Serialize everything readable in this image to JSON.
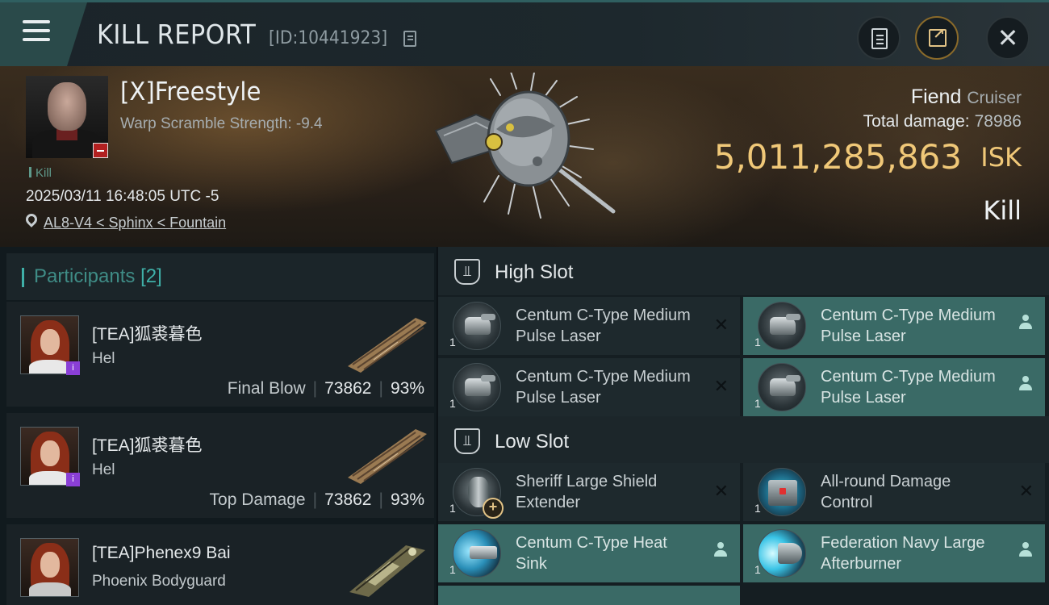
{
  "header": {
    "title": "KILL REPORT",
    "report_id": "[ID:10441923]",
    "icons": [
      "menu-icon",
      "copy-icon",
      "clipboard-icon",
      "share-icon",
      "close-icon"
    ],
    "close_glyph": "✕"
  },
  "victim": {
    "name": "[X]Freestyle",
    "warp_scramble": "Warp Scramble Strength: -9.4",
    "tag": "Kill",
    "timestamp": "2025/03/11 16:48:05 UTC -5",
    "location": "AL8-V4 < Sphinx < Fountain",
    "ship_name": "Fiend",
    "ship_class": "Cruiser",
    "total_damage_label": "Total damage:",
    "total_damage": "78986",
    "isk_value": "5,011,285,863",
    "isk_unit": "ISK",
    "result": "Kill"
  },
  "participants": {
    "title": "Participants",
    "count": "[2]",
    "items": [
      {
        "name": "[TEA]狐裘暮色",
        "ship": "Hel",
        "role": "Final Blow",
        "damage": "73862",
        "percent": "93%",
        "badge": "i"
      },
      {
        "name": "[TEA]狐裘暮色",
        "ship": "Hel",
        "role": "Top Damage",
        "damage": "73862",
        "percent": "93%",
        "badge": "i"
      },
      {
        "name": "[TEA]Phenex9 Bai",
        "ship": "Phoenix Bodyguard"
      }
    ]
  },
  "fittings": {
    "high_slot_title": "High Slot",
    "low_slot_title": "Low Slot",
    "high_slot": [
      {
        "name": "Centum C-Type Medium Pulse Laser",
        "qty": "1",
        "status": "destroyed",
        "status_glyph": "✕"
      },
      {
        "name": "Centum C-Type Medium Pulse Laser",
        "qty": "1",
        "status": "dropped"
      },
      {
        "name": "Centum C-Type Medium Pulse Laser",
        "qty": "1",
        "status": "destroyed",
        "status_glyph": "✕"
      },
      {
        "name": "Centum C-Type Medium Pulse Laser",
        "qty": "1",
        "status": "dropped"
      }
    ],
    "low_slot": [
      {
        "name": "Sheriff Large Shield Extender",
        "qty": "1",
        "status": "destroyed",
        "status_glyph": "✕"
      },
      {
        "name": "All-round Damage Control",
        "qty": "1",
        "status": "destroyed",
        "status_glyph": "✕"
      },
      {
        "name": "Centum C-Type Heat Sink",
        "qty": "1",
        "status": "dropped"
      },
      {
        "name": "Federation Navy Large Afterburner",
        "qty": "1",
        "status": "dropped"
      }
    ]
  },
  "colors": {
    "accent_teal": "#3fb0a8",
    "isk_gold": "#f0c878",
    "dropped_module_bg": "#3a6a66",
    "destroyed_module_bg": "#1e292d"
  }
}
